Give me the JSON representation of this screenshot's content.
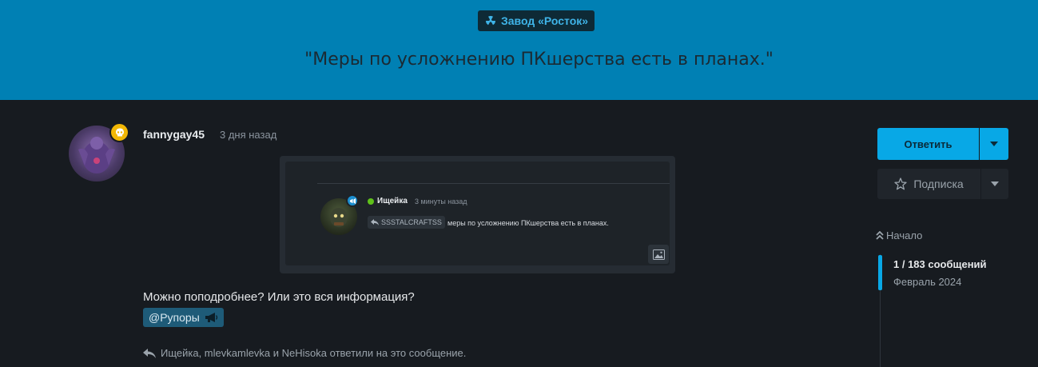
{
  "header": {
    "category": "Завод «Росток»",
    "title": "\"Меры по усложнению ПКшерства есть в планах.\"",
    "colors": {
      "bar": "#0080b4",
      "badge_bg": "#0e2a36",
      "badge_text": "#3fb4e8"
    }
  },
  "post": {
    "username": "fannygay45",
    "date": "3 дня назад",
    "image": {
      "author": "Ищейка",
      "time": "3 минуты назад",
      "reply_to": "SSSTALCRAFTSS",
      "text": "меры по усложнению ПКшерства есть в планах."
    },
    "body": "Можно поподробнее? Или это вся информация?",
    "mention": "@Рупоры",
    "replies": "Ищейка, mlevkamlevka и NeHisoka ответили на это сообщение."
  },
  "sidebar": {
    "reply_label": "Ответить",
    "subscribe_label": "Подписка",
    "timeline_start": "Начало",
    "timeline_count": "1 / 183 сообщений",
    "timeline_date": "Февраль 2024",
    "accent": "#08a8e6"
  },
  "icons": [
    "radioactive-icon",
    "skull-icon",
    "reply-icon",
    "megaphone-icon",
    "image-icon",
    "caret-down-icon",
    "star-icon",
    "double-chevron-up-icon"
  ]
}
